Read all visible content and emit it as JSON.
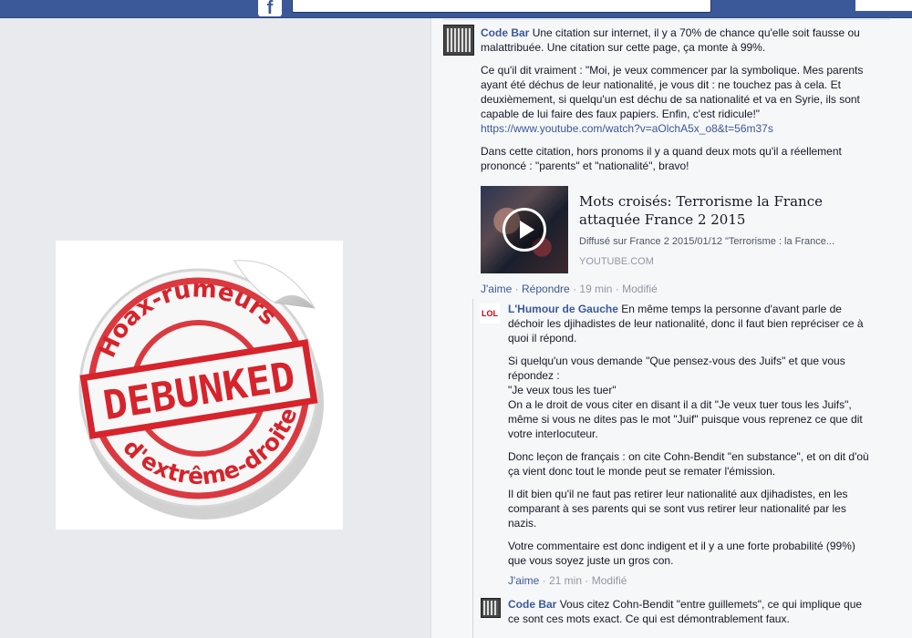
{
  "colors": {
    "topbar": "#3b5998",
    "link": "#3b5998",
    "stamp_red": "#d7232b",
    "feed_bg": "#f6f7f9",
    "page_bg": "#e9eaed"
  },
  "topbar": {
    "logo_icon": "facebook-f-icon",
    "logo_glyph": "f"
  },
  "stamp": {
    "top_text": "Hoax-rumeurs",
    "center_text": "DEBUNKED",
    "bottom_text": "d'extrême-droite"
  },
  "comments": [
    {
      "author": "Code Bar",
      "avatar_icon": "barcode-avatar-icon",
      "body_first": "Une citation sur internet, il y a 70% de chance qu'elle soit fausse ou malattribuée. Une citation sur cette page, ça monte à 99%.",
      "para2": "Ce qu'il dit vraiment : \"Moi, je veux commencer par la symbolique. Mes parents ayant été déchus de leur nationalité, je vous dit : ne touchez pas à cela. Et deuxièmement, si quelqu'un est déchu de sa nationalité et va en Syrie, ils sont capable de lui faire des faux papiers. Enfin, c'est ridicule!\"",
      "url": "https://www.youtube.com/watch?v=aOlchA5x_o8&t=56m37s",
      "para3": "Dans cette citation, hors pronoms il y a quand deux mots qu'il a réellement prononcé : \"parents\" et \"nationalité\", bravo!",
      "video": {
        "title": "Mots croisés: Terrorisme la France attaquée France 2 2015",
        "description": "Diffusé sur France 2 2015/01/12 \"Terrorisme : la France...",
        "source": "YOUTUBE.COM",
        "play_icon": "play-icon"
      },
      "meta": {
        "like": "J'aime",
        "reply": "Répondre",
        "time": "19 min",
        "edited": "Modifié"
      }
    },
    {
      "author": "L'Humour de Gauche",
      "avatar_text": "LOL",
      "body_first": "En même temps la personne d'avant parle de déchoir les djihadistes de leur nationalité, donc il faut bien repréciser ce à quoi il répond.",
      "para2": "Si quelqu'un vous demande \"Que pensez-vous des Juifs\" et que vous répondez :",
      "para2_line2": "\"Je veux tous les tuer\"",
      "para2_line3": "On a le droit de vous citer en disant il a dit \"Je veux tuer tous les Juifs\", même si vous ne dites pas le mot \"Juif\" puisque vous reprenez ce que dit votre interlocuteur.",
      "para3": "Donc leçon de français : on cite Cohn-Bendit \"en substance\", et on dit d'où ça vient donc tout le monde peut se remater l'émission.",
      "para4": "Il dit bien qu'il ne faut pas retirer leur nationalité aux djihadistes, en les comparant à ses parents qui se sont vus retirer leur nationalité par les nazis.",
      "para5": "Votre commentaire est donc indigent et il y a une forte probabilité (99%) que vous soyez juste un gros con.",
      "meta": {
        "like": "J'aime",
        "time": "21 min",
        "edited": "Modifié"
      }
    },
    {
      "author": "Code Bar",
      "avatar_icon": "barcode-avatar-icon",
      "body_first": "Vous citez Cohn-Bendit \"entre guillemets\", ce qui implique que ce sont ces mots exact. Ce qui est démontrablement faux."
    }
  ]
}
